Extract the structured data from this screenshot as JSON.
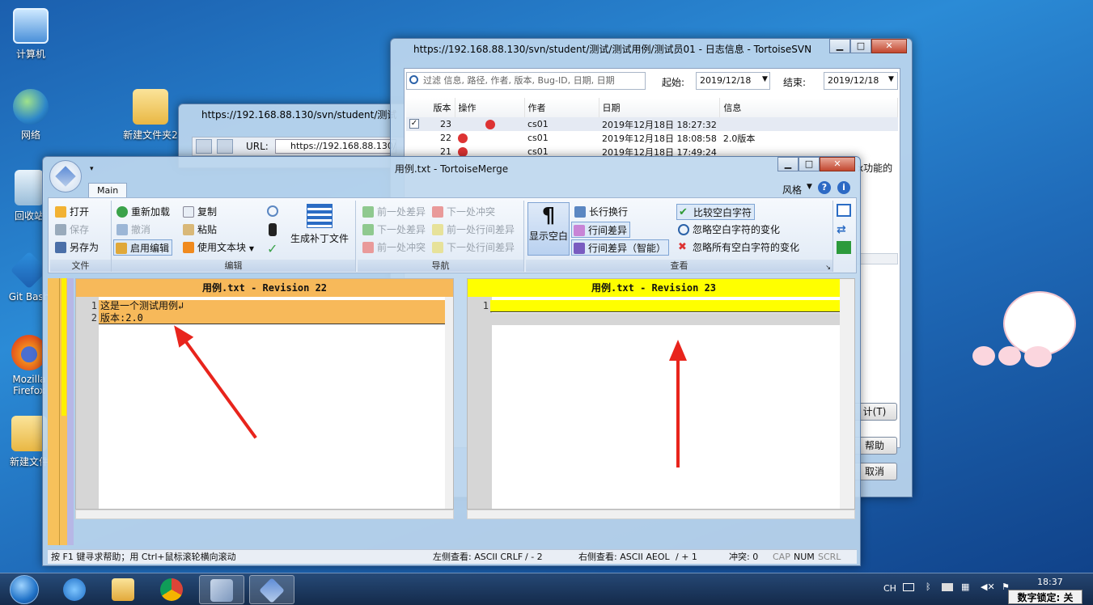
{
  "desktop": {
    "icons": [
      {
        "label": "计算机"
      },
      {
        "label": "网络"
      },
      {
        "label": "新建文件夹2"
      },
      {
        "label": "回收站"
      },
      {
        "label": "Git Bash"
      },
      {
        "label": "Mozilla Firefox"
      },
      {
        "label": "新建文件"
      }
    ]
  },
  "log_window": {
    "title": "https://192.168.88.130/svn/student/测试/测试用例/测试员01 - 日志信息 - TortoiseSVN",
    "filter_placeholder": "过滤 信息, 路径, 作者, 版本, Bug-ID, 日期, 日期",
    "from_label": "起始:",
    "from_value": "2019/12/18",
    "to_label": "结束:",
    "to_value": "2019/12/18",
    "columns": [
      "版本",
      "操作",
      "作者",
      "日期",
      "信息"
    ],
    "rows": [
      {
        "rev": "23",
        "author": "cs01",
        "date": "2019年12月18日 18:27:32",
        "msg": ""
      },
      {
        "rev": "22",
        "author": "cs01",
        "date": "2019年12月18日 18:08:58",
        "msg": "2.0版本"
      },
      {
        "rev": "21",
        "author": "cs01",
        "date": "2019年12月18日 17:49:24",
        "msg": ""
      }
    ],
    "side_text": "x功能的",
    "btn_stats": "计(T)",
    "btn_help": "帮助",
    "btn_cancel": "取消"
  },
  "repo_window": {
    "title": "https://192.168.88.130/svn/student/测试",
    "url_label": "URL:",
    "url_value": "https://192.168.88.130/s"
  },
  "merge_window": {
    "title": "用例.txt - TortoiseMerge",
    "tab": "Main",
    "style_label": "风格",
    "groups": {
      "file": "文件",
      "edit": "编辑",
      "nav": "导航",
      "view": "查看"
    },
    "file_buttons": [
      "打开",
      "保存",
      "另存为"
    ],
    "edit_buttons": [
      "重新加载",
      "撤消",
      "启用编辑",
      "复制",
      "粘贴",
      "使用文本块"
    ],
    "patch_button": "生成补丁文件",
    "nav_buttons": [
      "前一处差异",
      "下一处冲突",
      "下一处差异",
      "前一处行间差异",
      "前一处冲突",
      "下一处行间差异"
    ],
    "view_buttons": [
      "显示空白",
      "长行换行",
      "行间差异",
      "行间差异（智能）",
      "比较空白字符",
      "忽略空白字符的变化",
      "忽略所有空白字符的变化"
    ],
    "left_header": "用例.txt - Revision 22",
    "right_header": "用例.txt - Revision 23",
    "left_lines": [
      {
        "num": "1",
        "text": "这是一个测试用例↲"
      },
      {
        "num": "2",
        "text": "版本:2.0"
      }
    ],
    "right_lines": [
      {
        "num": "1",
        "text": ""
      }
    ],
    "status": {
      "help": "按 F1 键寻求帮助；用 Ctrl+鼠标滚轮横向滚动",
      "left_view": "左侧查看: ASCII CRLF",
      "left_change": "/ - 2",
      "right_view": "右侧查看: ASCII AEOL",
      "right_change": "/ + 1",
      "conflicts": "冲突: 0",
      "cap": "CAP",
      "num": "NUM",
      "scrl": "SCRL"
    }
  },
  "taskbar": {
    "lang": "CH",
    "time": "18:37",
    "numlock": "数字锁定: 关"
  }
}
